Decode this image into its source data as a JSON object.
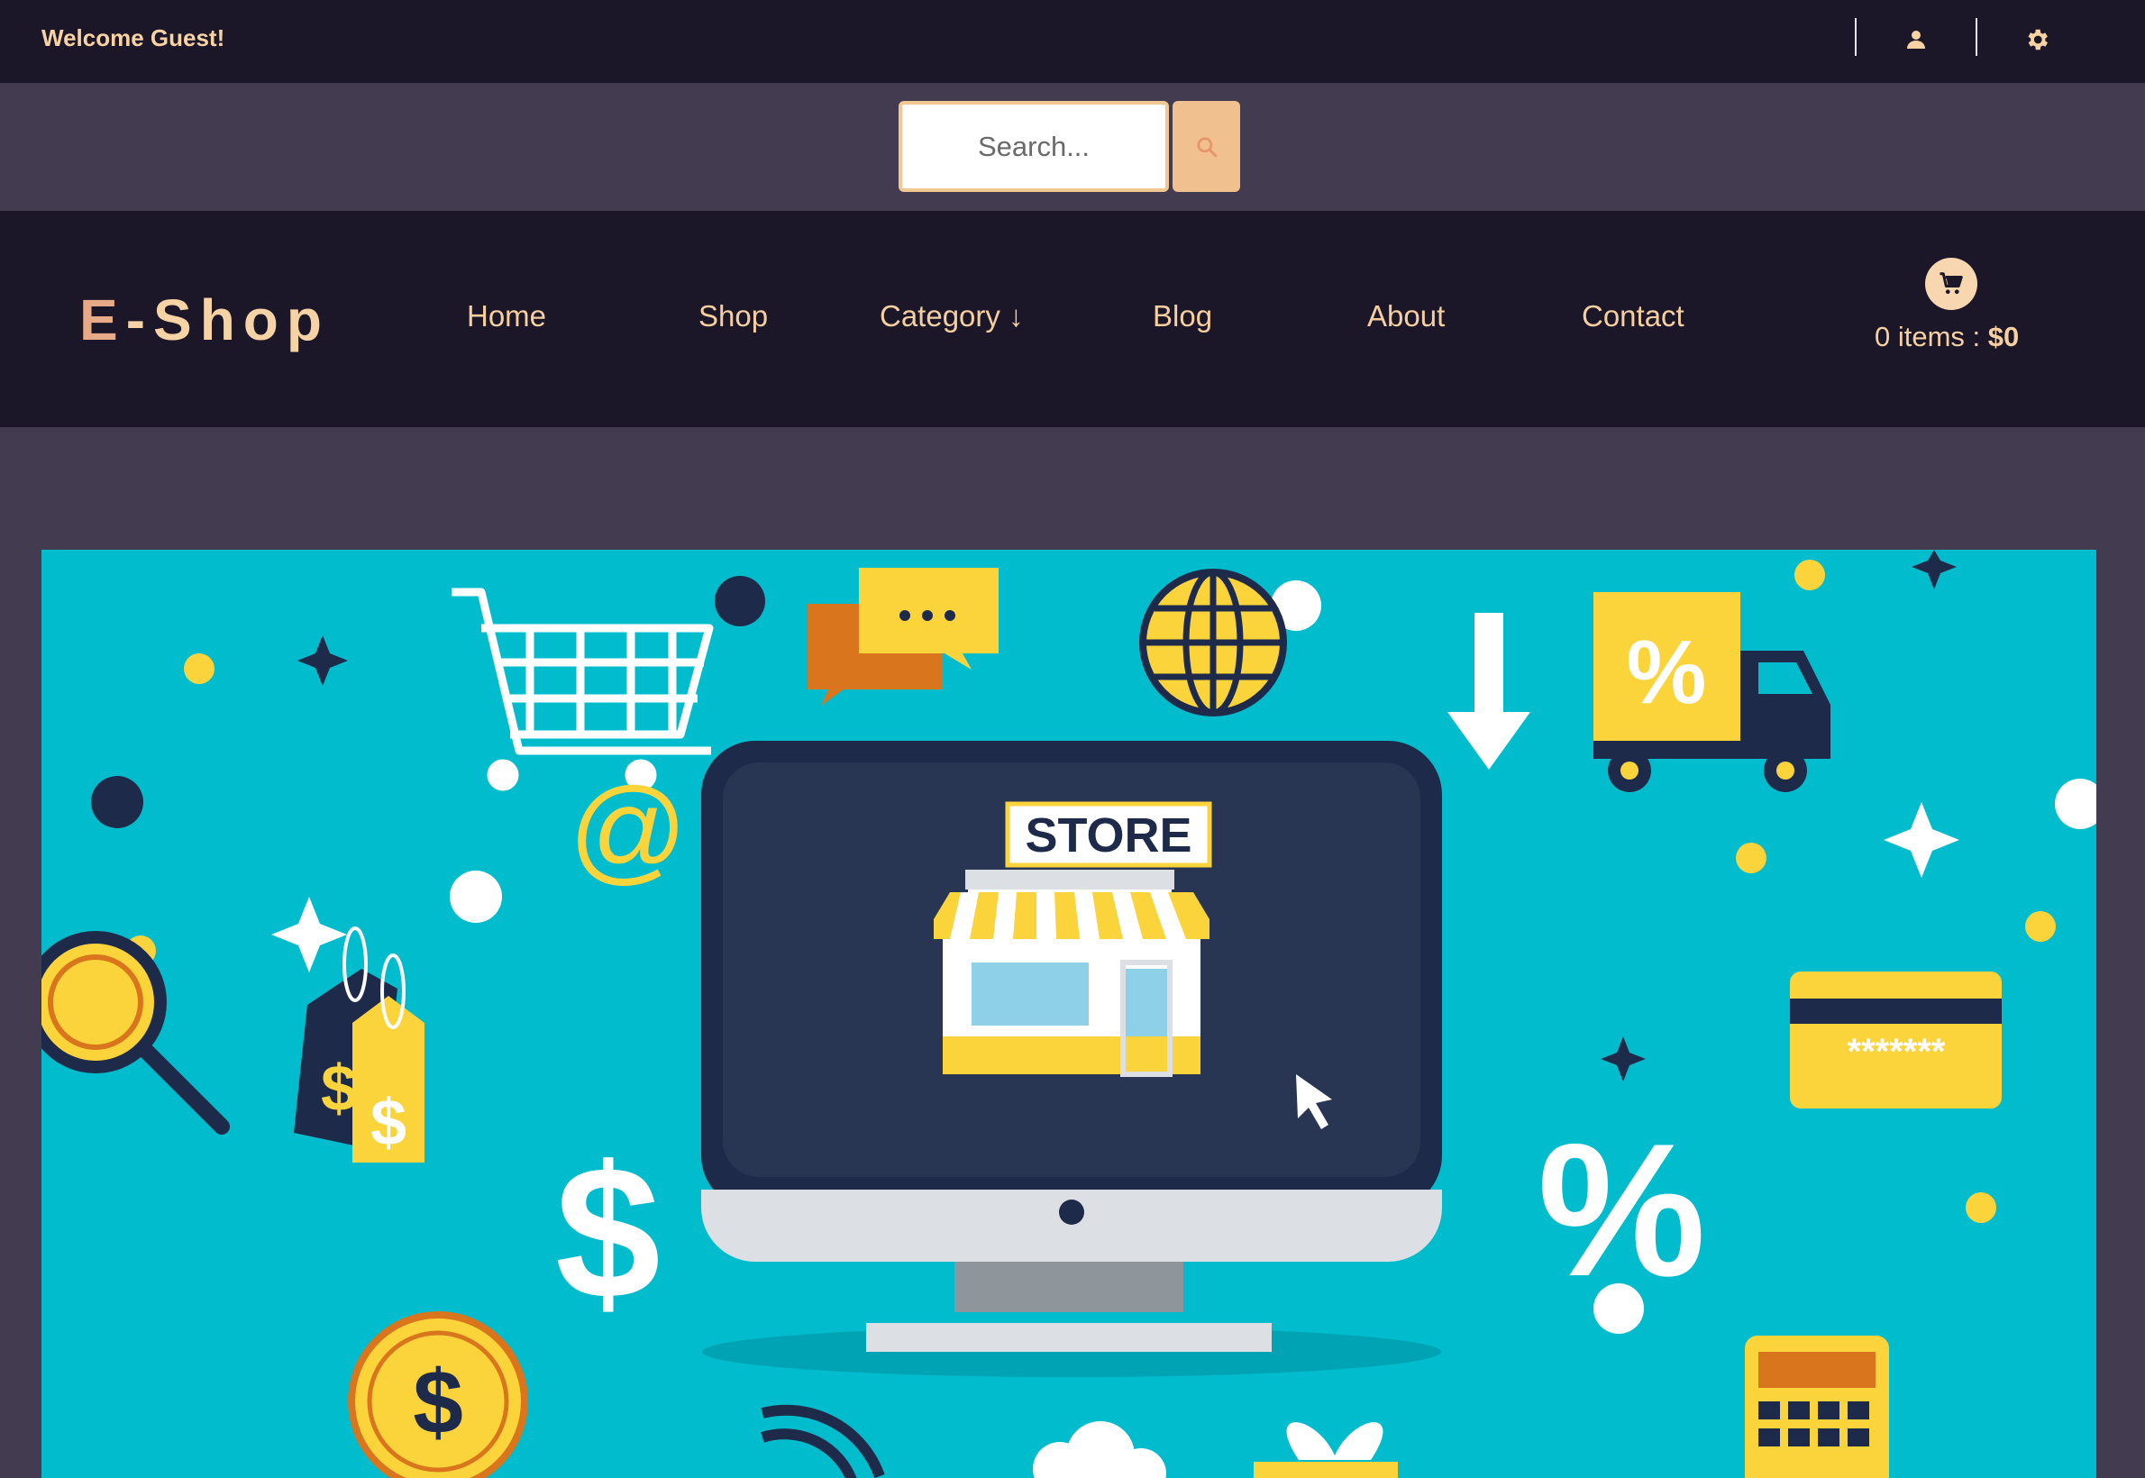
{
  "topbar": {
    "welcome": "Welcome Guest!",
    "icons": [
      "user-icon",
      "gear-icon"
    ]
  },
  "search": {
    "placeholder": "Search...",
    "button_icon": "search-icon"
  },
  "brand": {
    "logo_first": "E",
    "logo_rest": "-Shop"
  },
  "nav": {
    "items": [
      {
        "label": "Home"
      },
      {
        "label": "Shop"
      },
      {
        "label": "Category ↓"
      },
      {
        "label": "Blog"
      },
      {
        "label": "About"
      },
      {
        "label": "Contact"
      }
    ]
  },
  "cart": {
    "icon": "cart-icon",
    "items_label": "0 items : ",
    "total": "$0"
  },
  "banner": {
    "store_sign": "STORE",
    "card_number": "*******",
    "percent_tag": "%",
    "percent_big": "%",
    "dollar": "$",
    "at_sign": "@"
  },
  "colors": {
    "bar_dark": "#1c1629",
    "bar_mid": "#433b4f",
    "accent": "#f6d3a4",
    "banner_bg": "#00bccc",
    "yellow": "#fbd43c",
    "navy": "#1e2a4a"
  }
}
